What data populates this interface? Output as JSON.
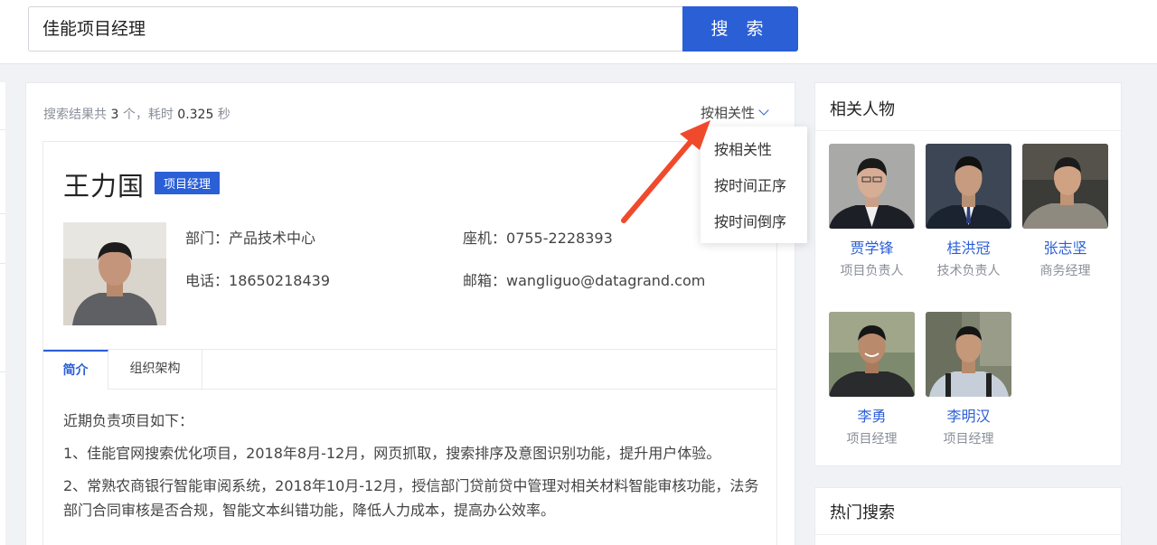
{
  "search": {
    "query": "佳能项目经理",
    "button_label": "搜 索"
  },
  "results": {
    "summary_prefix": "搜索结果共 ",
    "count": "3",
    "summary_mid": " 个，耗时 ",
    "time": "0.325",
    "summary_suffix": " 秒",
    "sort_label": "按相关性"
  },
  "sort_menu": {
    "options": [
      "按相关性",
      "按时间正序",
      "按时间倒序"
    ]
  },
  "person": {
    "name": "王力国",
    "role": "项目经理",
    "department_label": "部门：",
    "department": "产品技术中心",
    "landline_label": "座机：",
    "landline": "0755-2228393",
    "phone_label": "电话：",
    "phone": "18650218439",
    "email_label": "邮箱：",
    "email": "wangliguo@datagrand.com"
  },
  "tabs": [
    "简介",
    "组织架构"
  ],
  "intro": {
    "heading": "近期负责项目如下：",
    "items": [
      "1、佳能官网搜索优化项目，2018年8月-12月，网页抓取，搜索排序及意图识别功能，提升用户体验。",
      "2、常熟农商银行智能审阅系统，2018年10月-12月，授信部门贷前贷中管理对相关材料智能审核功能，法务部门合同审核是否合规，智能文本纠错功能，降低人力成本，提高办公效率。"
    ]
  },
  "related": {
    "title": "相关人物",
    "people": [
      {
        "name": "贾学锋",
        "title": "项目负责人"
      },
      {
        "name": "桂洪冠",
        "title": "技术负责人"
      },
      {
        "name": "张志坚",
        "title": "商务经理"
      },
      {
        "name": "李勇",
        "title": "项目经理"
      },
      {
        "name": "李明汉",
        "title": "项目经理"
      }
    ]
  },
  "hot_search": {
    "title": "热门搜索"
  },
  "colors": {
    "accent": "#2b5fd6",
    "arrow": "#f04a2c",
    "background": "#f0f2f5"
  }
}
